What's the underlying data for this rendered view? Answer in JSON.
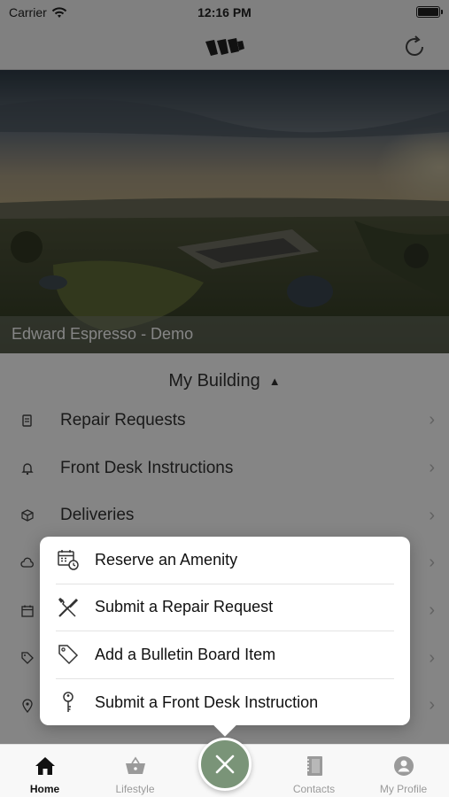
{
  "status_bar": {
    "carrier": "Carrier",
    "time": "12:16 PM"
  },
  "hero": {
    "caption": "Edward Espresso - Demo"
  },
  "section": {
    "title": "My Building",
    "caret": "▲"
  },
  "menu": {
    "items": [
      {
        "label": "Repair Requests",
        "icon": "repair-icon"
      },
      {
        "label": "Front Desk Instructions",
        "icon": "bell-icon"
      },
      {
        "label": "Deliveries",
        "icon": "package-icon"
      },
      {
        "label": "",
        "icon": "cloud-icon"
      },
      {
        "label": "",
        "icon": "calendar-icon"
      },
      {
        "label": "",
        "icon": "tag-icon"
      },
      {
        "label": "",
        "icon": "location-pin-icon"
      }
    ]
  },
  "popup": {
    "items": [
      {
        "label": "Reserve an Amenity",
        "icon": "calendar-clock-icon"
      },
      {
        "label": "Submit a Repair Request",
        "icon": "tools-icon"
      },
      {
        "label": "Add a Bulletin Board Item",
        "icon": "tag-icon"
      },
      {
        "label": "Submit a Front Desk Instruction",
        "icon": "key-icon"
      }
    ]
  },
  "tabs": [
    {
      "label": "Home",
      "icon": "home-icon",
      "active": true
    },
    {
      "label": "Lifestyle",
      "icon": "basket-icon",
      "active": false
    },
    {
      "label": "",
      "icon": "close-icon",
      "active": false
    },
    {
      "label": "Contacts",
      "icon": "contacts-book-icon",
      "active": false
    },
    {
      "label": "My Profile",
      "icon": "profile-icon",
      "active": false
    }
  ],
  "colors": {
    "fab": "#7a9478",
    "overlay": "rgba(0,0,0,0.48)"
  }
}
